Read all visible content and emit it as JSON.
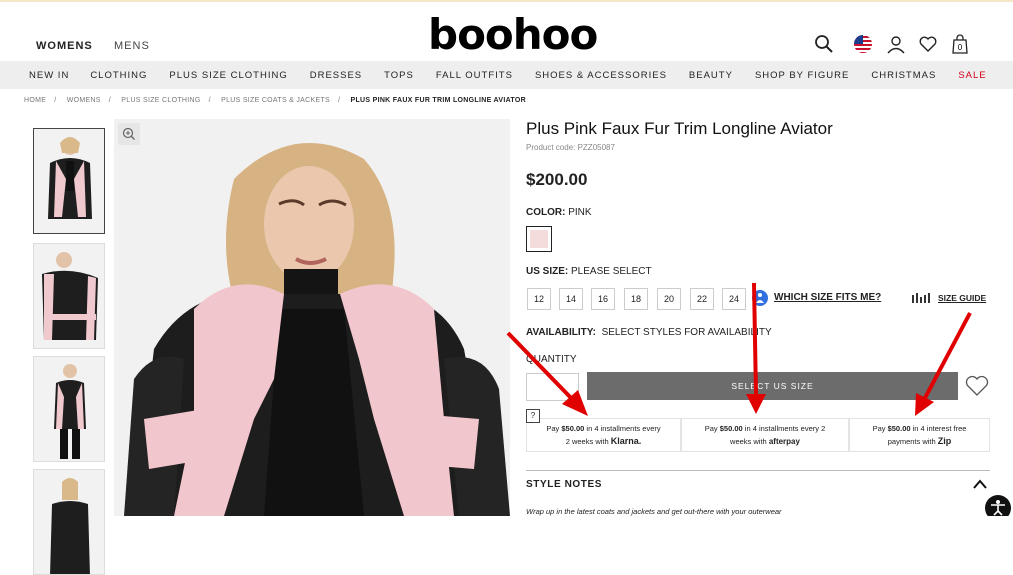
{
  "header": {
    "gender_tabs": [
      "WOMENS",
      "MENS"
    ],
    "logo": "boohoo",
    "bag_count": "0"
  },
  "nav": {
    "items": [
      "NEW IN",
      "CLOTHING",
      "PLUS SIZE CLOTHING",
      "DRESSES",
      "TOPS",
      "FALL OUTFITS",
      "SHOES & ACCESSORIES",
      "BEAUTY",
      "SHOP BY FIGURE",
      "CHRISTMAS",
      "SALE"
    ],
    "sale_color": "#d0021b"
  },
  "breadcrumb": [
    "HOME",
    "WOMENS",
    "PLUS SIZE CLOTHING",
    "PLUS SIZE COATS & JACKETS",
    "PLUS PINK FAUX FUR TRIM LONGLINE AVIATOR"
  ],
  "product": {
    "title": "Plus Pink Faux Fur Trim Longline Aviator",
    "code_label": "Product code: PZZ05087",
    "price": "$200.00",
    "color_label": "COLOR:",
    "color_value": "PINK",
    "swatch_color": "#f4dcdc",
    "size_label": "US SIZE:",
    "size_value": "PLEASE SELECT",
    "sizes": [
      "12",
      "14",
      "16",
      "18",
      "20",
      "22",
      "24"
    ],
    "fit_link": "WHICH SIZE FITS ME?",
    "size_guide": "SIZE GUIDE",
    "availability_label": "AVAILABILITY:",
    "availability_value": "SELECT STYLES FOR AVAILABILITY",
    "quantity_label": "QUANTITY",
    "select_button": "SELECT US SIZE",
    "question_mark": "?"
  },
  "payments": [
    {
      "line1_pre": "Pay ",
      "amount": "$50.00",
      "line1_post": " in 4 installments every",
      "line2": "2 weeks with",
      "brand": "Klarna."
    },
    {
      "line1_pre": "Pay ",
      "amount": "$50.00",
      "line1_post": " in 4 installments every 2",
      "line2": "weeks with",
      "brand": "afterpay"
    },
    {
      "line1_pre": "Pay ",
      "amount": "$50.00",
      "line1_post": " in 4 interest free",
      "line2": "payments with",
      "brand": "Zip"
    }
  ],
  "style_notes": {
    "heading": "STYLE NOTES",
    "text": "Wrap up in the latest coats and jackets and get out-there with your outerwear"
  },
  "icons": [
    "search-icon",
    "us-flag-icon",
    "account-icon",
    "heart-icon",
    "bag-icon",
    "zoom-icon",
    "ruler-icon",
    "wishlist-heart-icon",
    "chevron-up-icon",
    "accessibility-icon"
  ],
  "annotation_color": "#e00000"
}
